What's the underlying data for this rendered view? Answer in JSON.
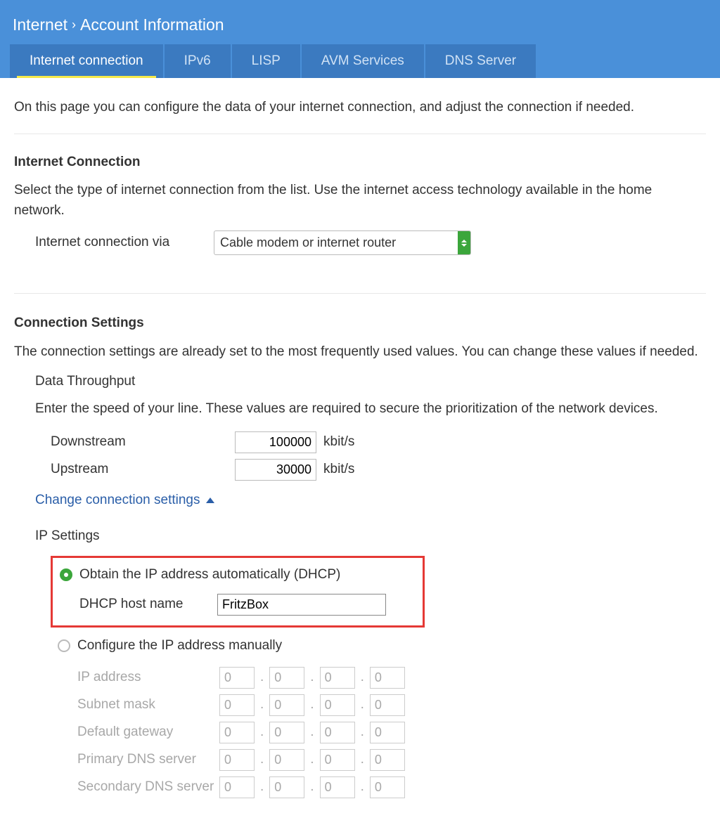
{
  "breadcrumb": {
    "section": "Internet",
    "page": "Account Information"
  },
  "tabs": [
    {
      "label": "Internet connection",
      "active": true
    },
    {
      "label": "IPv6",
      "active": false
    },
    {
      "label": "LISP",
      "active": false
    },
    {
      "label": "AVM Services",
      "active": false
    },
    {
      "label": "DNS Server",
      "active": false
    }
  ],
  "intro": "On this page you can configure the data of your internet connection, and adjust the connection if needed.",
  "internet_connection": {
    "title": "Internet Connection",
    "desc": "Select the type of internet connection from the list. Use the internet access technology available in the home network.",
    "via_label": "Internet connection via",
    "via_value": "Cable modem or internet router"
  },
  "connection_settings": {
    "title": "Connection Settings",
    "desc": "The connection settings are already set to the most frequently used values. You can change these values if needed.",
    "throughput_title": "Data Throughput",
    "throughput_desc": "Enter the speed of your line. These values are required to secure the prioritization of the network devices.",
    "downstream_label": "Downstream",
    "downstream_value": "100000",
    "upstream_label": "Upstream",
    "upstream_value": "30000",
    "unit": "kbit/s",
    "toggle_label": "Change connection settings"
  },
  "ip_settings": {
    "title": "IP Settings",
    "dhcp_radio_label": "Obtain the IP address automatically (DHCP)",
    "dhcp_host_label": "DHCP host name",
    "dhcp_host_value": "FritzBox",
    "manual_radio_label": "Configure the IP address manually",
    "fields": [
      {
        "label": "IP address",
        "octets": [
          "0",
          "0",
          "0",
          "0"
        ]
      },
      {
        "label": "Subnet mask",
        "octets": [
          "0",
          "0",
          "0",
          "0"
        ]
      },
      {
        "label": "Default gateway",
        "octets": [
          "0",
          "0",
          "0",
          "0"
        ]
      },
      {
        "label": "Primary DNS server",
        "octets": [
          "0",
          "0",
          "0",
          "0"
        ]
      },
      {
        "label": "Secondary DNS server",
        "octets": [
          "0",
          "0",
          "0",
          "0"
        ]
      }
    ]
  }
}
